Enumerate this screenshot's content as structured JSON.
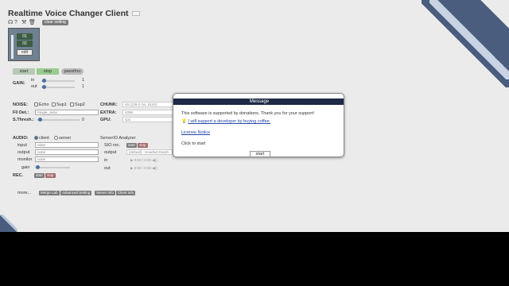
{
  "header": {
    "title": "Realtime Voice Changer Client",
    "clear_setting": "clear setting"
  },
  "icons": [
    "github-icon",
    "help-icon",
    "wrench-icon",
    "trash-icon"
  ],
  "model": {
    "slot1": "01",
    "slot2": "02",
    "edit": "edit"
  },
  "controls": {
    "start": "start",
    "stop": "stop",
    "passthru": "passthru"
  },
  "gain": {
    "label": "GAIN:",
    "in_label": "in",
    "in_value": "1",
    "out_label": "out",
    "out_value": "1"
  },
  "noise": {
    "label": "NOISE:",
    "echo": "Echo",
    "sup1": "Sup1",
    "sup2": "Sup2"
  },
  "chunk": {
    "label": "CHUNK:",
    "value": "48 (128.0 ms, 6144)"
  },
  "f0": {
    "label": "F0 Det.:",
    "value": "rmvpe_onnx"
  },
  "extra": {
    "label": "EXTRA:",
    "value": "4096"
  },
  "sthresh": {
    "label": "S.Thresh.:",
    "value": "0"
  },
  "gpu": {
    "label": "GPU:",
    "value": "cpu"
  },
  "audio": {
    "label": "AUDIO:",
    "client": "client",
    "server": "server",
    "input_label": "input",
    "input_value": "none",
    "output_label": "output",
    "output_value": "none",
    "monitor_label": "monitor",
    "monitor_value": "none",
    "gain_label": "gain"
  },
  "serverio": {
    "title": "ServerIO Analyzer",
    "sio_label": "SIO rec.",
    "sio_start": "start",
    "sio_stop": "stop",
    "output_label": "output",
    "output_value": "[default] - Headset Earph",
    "in_label": "in",
    "in_time": "0:00 / 0:00",
    "out_label": "out",
    "out_time": "0:00 / 0:00"
  },
  "rec": {
    "label": "REC.",
    "start": "start",
    "stop": "stop"
  },
  "more": {
    "label": "more...",
    "merge_lab": "Merge Lab",
    "advanced": "Advanced Setting",
    "server_info": "Server Info",
    "client_info": "Client Info"
  },
  "dialog": {
    "title": "Message",
    "body": "This software is supported by donations. Thank you for your support!",
    "donate_link": "I will support a developer by buying coffee.",
    "license": "License Notice",
    "click_to_start": "Click to start",
    "start": "start"
  },
  "colors": {
    "accent": "#4a6fa5",
    "dialog_header": "#1c2a45",
    "stop_button": "#9acb8e",
    "corner_deco": "#4a5d7e"
  }
}
